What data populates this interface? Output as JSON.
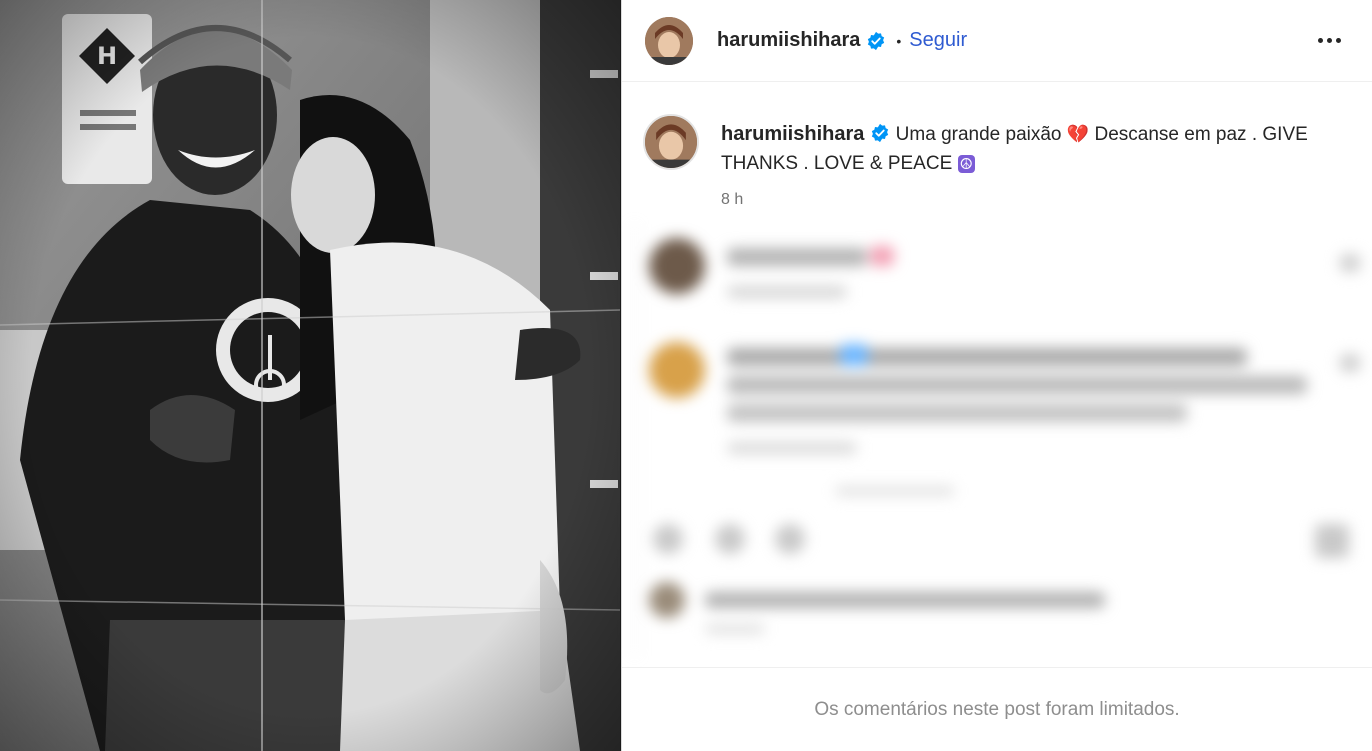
{
  "post": {
    "username": "harumiishihara",
    "follow_label": "Seguir",
    "separator": "•",
    "more_label": "More options"
  },
  "caption": {
    "username": "harumiishihara",
    "text_1": "Uma grande paixão",
    "text_2": "Descanse em paz . GIVE THANKS . LOVE & PEACE",
    "heart_emoji": "💔",
    "peace_emoji": "☮",
    "timestamp": "8 h"
  },
  "footer": {
    "comments_limited": "Os comentários neste post foram limitados."
  },
  "colors": {
    "accent": "#2f5bd1",
    "verified": "#0095f6",
    "muted": "#8e8e8e"
  },
  "icons": {
    "verified": "verified-badge-icon",
    "more": "more-options-icon"
  }
}
